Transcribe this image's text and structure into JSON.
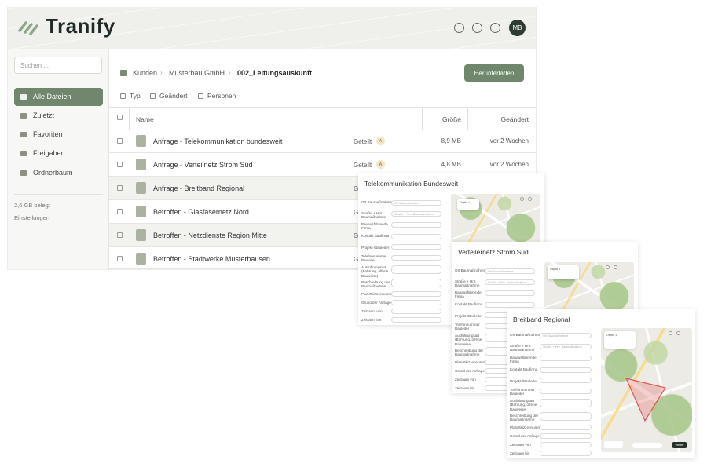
{
  "app": {
    "logo_text": "Tranify",
    "avatar_initials": "MB"
  },
  "sidebar": {
    "search_placeholder": "Suchen ...",
    "items": [
      {
        "label": "Alle Dateien"
      },
      {
        "label": "Zuletzt"
      },
      {
        "label": "Favoriten"
      },
      {
        "label": "Freigaben"
      },
      {
        "label": "Ordnerbaum"
      }
    ],
    "storage": "2,6 GB belegt",
    "settings": "Einstellungen"
  },
  "breadcrumb": {
    "root": "Kunden",
    "level1": "Musterbau GmbH",
    "current": "002_Leitungsauskunft"
  },
  "toolbar": {
    "download_label": "Herunterladen"
  },
  "filters": [
    "Typ",
    "Geändert",
    "Personen"
  ],
  "table": {
    "headers": {
      "name": "Name",
      "size": "Größe",
      "changed": "Geändert"
    },
    "rows": [
      {
        "name": "Anfrage   - Telekommunikation bundesweit",
        "shared": "Geteilt",
        "avatar": "A",
        "size": "8,9 MB",
        "changed": "vor 2 Wochen"
      },
      {
        "name": "Anfrage   - Verteilnetz Strom Süd",
        "shared": "Geteilt",
        "avatar": "A",
        "size": "4,8 MB",
        "changed": "vor 2 Wochen"
      },
      {
        "name": "Anfrage   - Breitband Regional",
        "shared": "G",
        "avatar": "",
        "size": "",
        "changed": ""
      },
      {
        "name": "Betroffen - Glasfasernetz Nord",
        "shared": "G",
        "avatar": "",
        "size": "",
        "changed": ""
      },
      {
        "name": "Betroffen - Netzdienste Region Mitte",
        "shared": "G",
        "avatar": "",
        "size": "",
        "changed": ""
      },
      {
        "name": "Betroffen - Stadtwerke Musterhausen",
        "shared": "G",
        "avatar": "",
        "size": "",
        "changed": ""
      }
    ]
  },
  "previews": [
    {
      "title": "Telekommunikation Bundesweit"
    },
    {
      "title": "Verteilernetz Strom Süd"
    },
    {
      "title": "Breitband Regional"
    }
  ],
  "form": {
    "labels": [
      "Ort Baumaßnahme",
      "Straße + Hnr. Baumaßnahme",
      "Bauausführende Firma",
      "Kontakt Baufirma",
      "Projekt-/Bauleiter",
      "Telefonnummer Bauleiter",
      "Ausführungsart (Bohrung, offene Bauweise)",
      "Beschreibung der Baumaßnahme",
      "Plan/Skizzennummer",
      "Grund der Anfrage",
      "Zeitraum von",
      "Zeitraum bis"
    ],
    "placeholder_ort": "Ort Baumaßnahme",
    "placeholder_strasse": "Straße + Hnr. Baumaßnahme"
  },
  "map": {
    "card_label": "Objekt 1",
    "status": "Weiter"
  },
  "colors": {
    "accent": "#71876d",
    "polygon": "#e05555"
  }
}
